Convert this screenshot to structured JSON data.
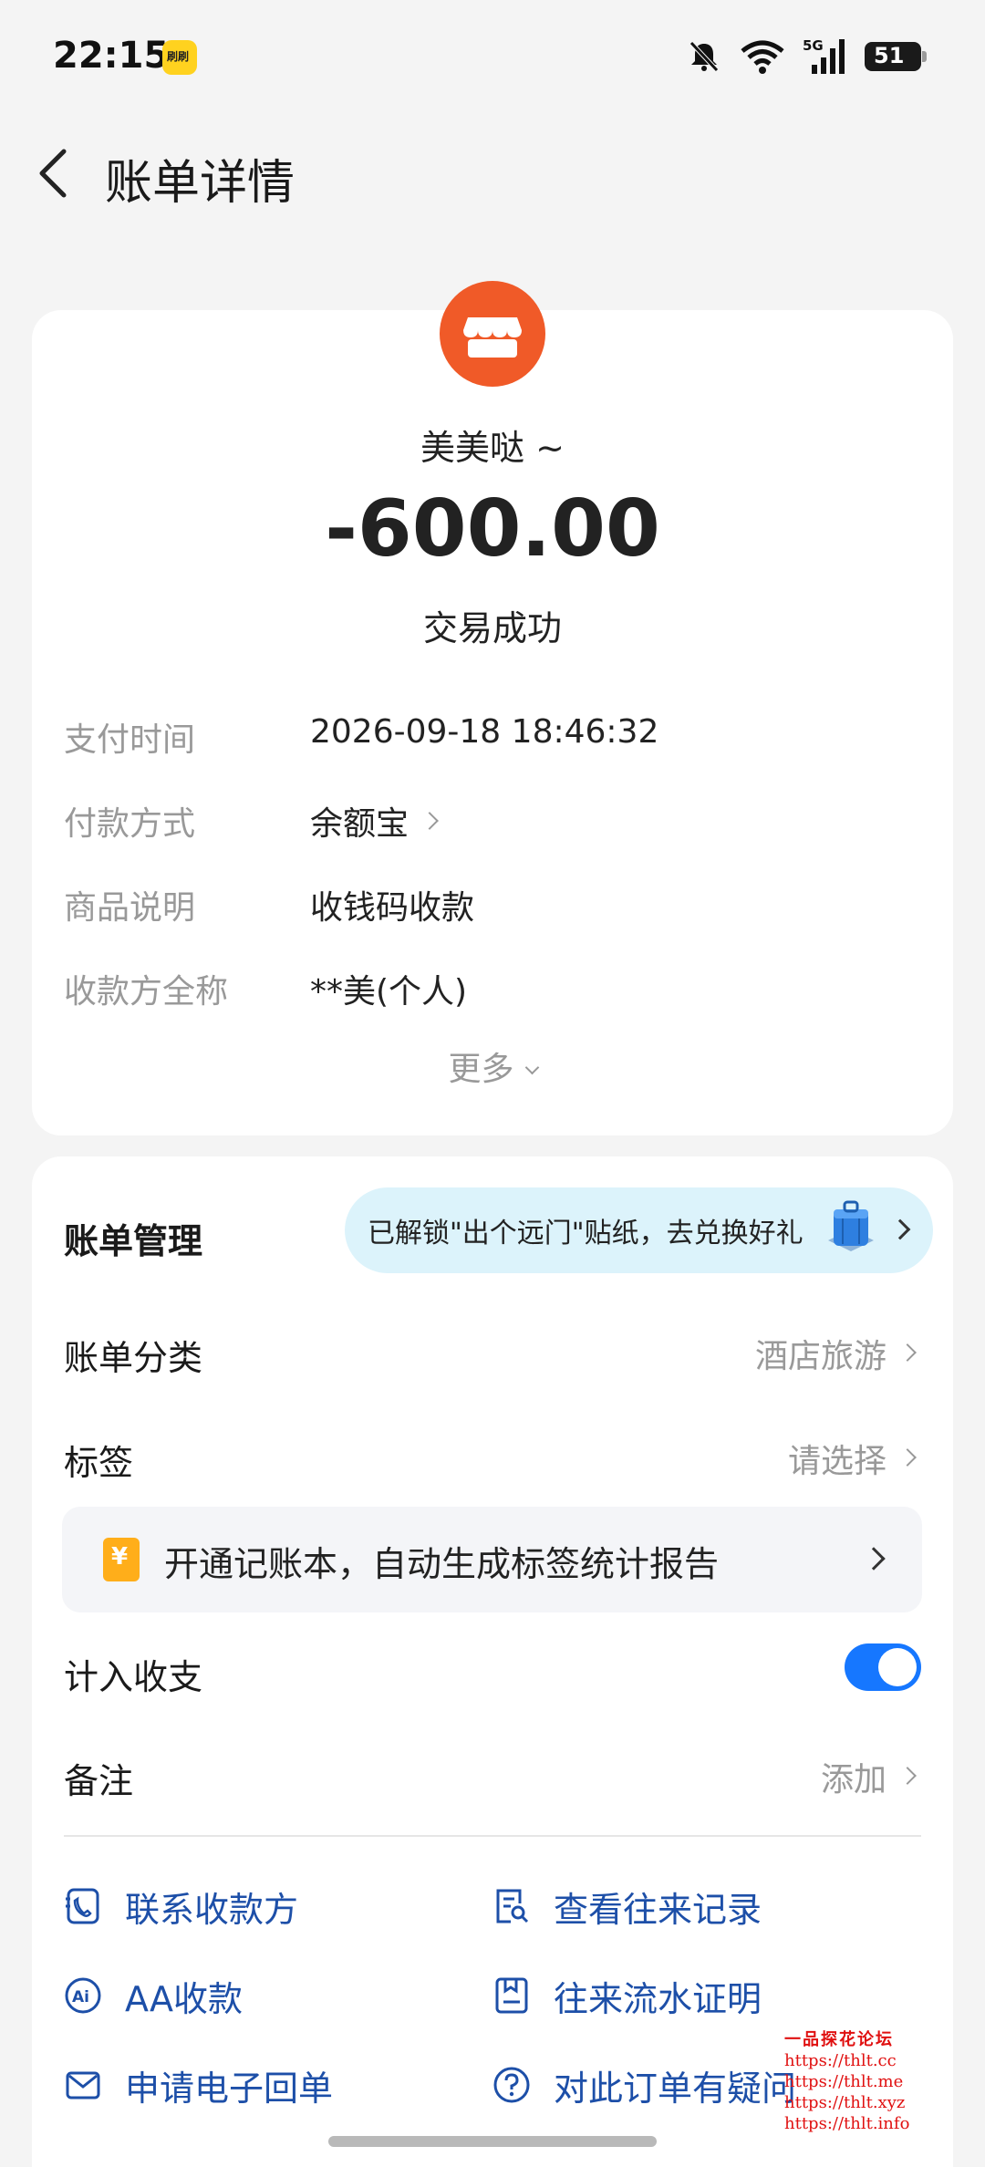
{
  "status_bar": {
    "time": "22:15",
    "app_badge": "刷刷",
    "battery": "51"
  },
  "nav": {
    "title": "账单详情"
  },
  "bill": {
    "merchant": "美美哒 ~",
    "amount": "-600.00",
    "status": "交易成功",
    "details": [
      {
        "label": "支付时间",
        "value": "2026-09-18 18:46:32"
      },
      {
        "label": "付款方式",
        "value": "余额宝"
      },
      {
        "label": "商品说明",
        "value": "收钱码收款"
      },
      {
        "label": "收款方全称",
        "value": "**美(个人)"
      }
    ],
    "more": "更多"
  },
  "management": {
    "title": "账单管理",
    "promo": "已解锁\"出个远门\"贴纸，去兑换好礼",
    "category_label": "账单分类",
    "category_value": "酒店旅游",
    "tag_label": "标签",
    "tag_value": "请选择",
    "ledger_banner": "开通记账本，自动生成标签统计报告",
    "include_label": "计入收支",
    "include_on": true,
    "note_label": "备注",
    "note_value": "添加",
    "actions": [
      {
        "label": "联系收款方",
        "icon": "phone-icon"
      },
      {
        "label": "查看往来记录",
        "icon": "record-search-icon"
      },
      {
        "label": "AA收款",
        "icon": "aa-icon"
      },
      {
        "label": "往来流水证明",
        "icon": "document-icon"
      },
      {
        "label": "申请电子回单",
        "icon": "mail-icon"
      },
      {
        "label": "对此订单有疑问",
        "icon": "question-icon"
      }
    ]
  },
  "watermark": {
    "title": "一品探花论坛",
    "links": [
      "https://thlt.cc",
      "https://thlt.me",
      "https://thlt.xyz",
      "https://thlt.info"
    ]
  },
  "colors": {
    "accent": "#1677ff",
    "link": "#1d4fa8",
    "merchant": "#f05a28",
    "promo_bg": "#dcf3fb"
  }
}
